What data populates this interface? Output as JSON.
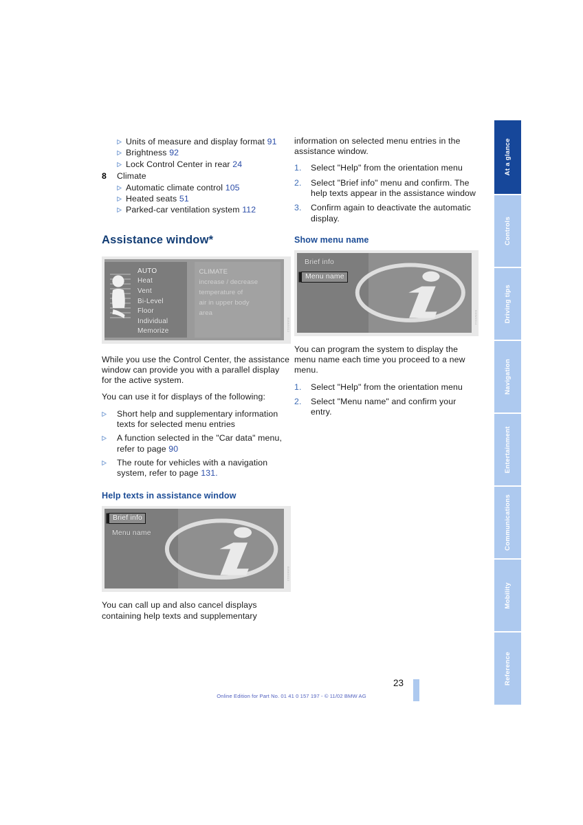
{
  "document": {
    "page_number": "23",
    "footer": "Online Edition for Part No. 01 41 0 157 197 - © 11/02 BMW AG"
  },
  "left_column": {
    "index_items": [
      {
        "number": "",
        "label": "Units of measure and display format",
        "page": "91"
      },
      {
        "number": "",
        "label": "Brightness",
        "page": "92"
      },
      {
        "number": "",
        "label": "Lock Control Center in rear",
        "page": "24"
      }
    ],
    "section": {
      "number": "8",
      "title": "Climate"
    },
    "section_items": [
      {
        "label": "Automatic climate control",
        "page": "105"
      },
      {
        "label": "Heated seats",
        "page": "51"
      },
      {
        "label": "Parked-car ventilation system",
        "page": "112"
      }
    ],
    "heading": "Assistance window*",
    "climate_figure": {
      "menu_items": [
        "AUTO",
        "Heat",
        "Vent",
        "Bi-Level",
        "Floor",
        "Individual",
        "Memorize"
      ],
      "info_title": "CLIMATE",
      "info_lines": [
        "increase / decrease",
        "temperature of",
        "air in upper body",
        "area"
      ],
      "caption_mark": "BMW0012"
    },
    "paragraph_1": "While you use the Control Center, the assistance window can provide you with a parallel display for the active system.",
    "paragraph_2": "You can use it for displays of the following:",
    "bullets": [
      {
        "text": "Short help and supplementary information texts for selected menu entries",
        "page": ""
      },
      {
        "text": "A function selected in the \"Car data\" menu, refer to page",
        "page": "90"
      },
      {
        "text": "The route for vehicles with a navigation system, refer to page",
        "page": "131."
      }
    ],
    "subheading": "Help texts in assistance window",
    "help_figure": {
      "item_selected": "Brief info",
      "item_other": "Menu name",
      "watermark": "i",
      "caption_mark": "BMW0013"
    },
    "paragraph_3": "You can call up and also cancel displays containing help texts and supplementary"
  },
  "right_column": {
    "paragraph_top": "information on selected menu entries in the assistance window.",
    "steps_help": [
      {
        "num": "1.",
        "text": "Select \"Help\" from the orientation menu"
      },
      {
        "num": "2.",
        "text": "Select \"Brief info\" menu and confirm. The help texts appear in the assistance window"
      },
      {
        "num": "3.",
        "text": "Confirm again to deactivate the automatic display."
      }
    ],
    "subheading": "Show menu name",
    "menu_figure": {
      "item_other": "Brief info",
      "item_selected": "Menu name",
      "watermark": "i",
      "caption_mark": "BMW0014"
    },
    "paragraph_mid": "You can program the system to display the menu name each time you proceed to a new menu.",
    "steps_menu": [
      {
        "num": "1.",
        "text": "Select \"Help\" from the orientation menu"
      },
      {
        "num": "2.",
        "text": "Select \"Menu name\" and confirm your entry."
      }
    ]
  },
  "sidebar": {
    "tabs": [
      {
        "label": "At a glance",
        "active": true
      },
      {
        "label": "Controls",
        "active": false
      },
      {
        "label": "Driving tips",
        "active": false
      },
      {
        "label": "Navigation",
        "active": false
      },
      {
        "label": "Entertainment",
        "active": false
      },
      {
        "label": "Communications",
        "active": false
      },
      {
        "label": "Mobility",
        "active": false
      },
      {
        "label": "Reference",
        "active": false
      }
    ]
  },
  "colors": {
    "heading_navy": "#113c74",
    "subheading_blue": "#1c4c96",
    "tab_active": "#16479a",
    "tab_inactive": "#adc9ef",
    "page_ref_blue": "#2b4da8",
    "footer_blue": "#4f5fbe"
  }
}
